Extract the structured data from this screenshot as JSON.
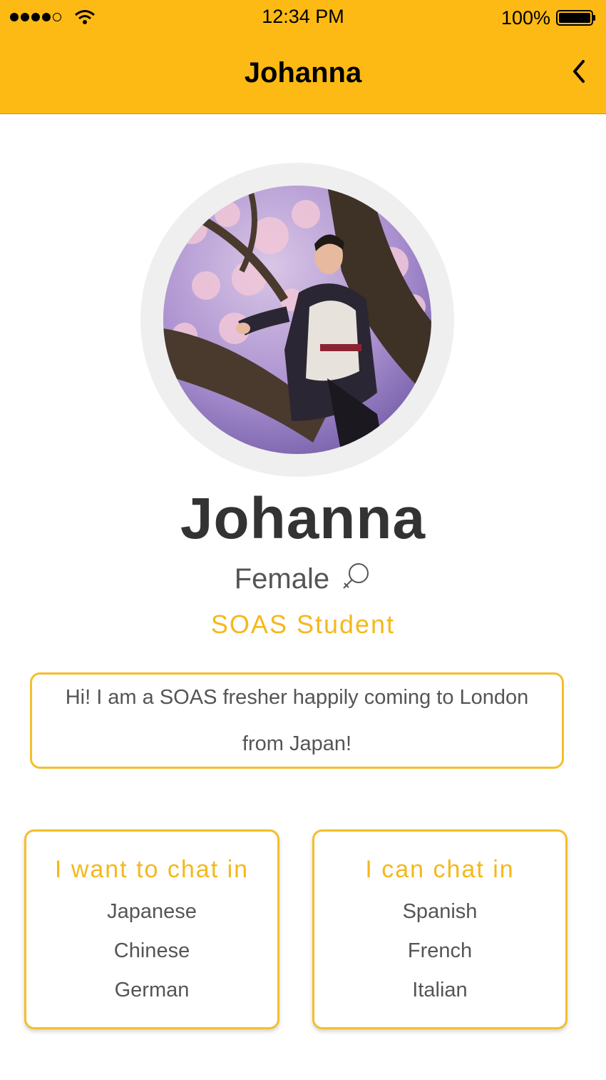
{
  "status_bar": {
    "time": "12:34 PM",
    "battery": "100%",
    "signal_icon": "signal-icon",
    "wifi_icon": "wifi-icon",
    "battery_icon": "battery-icon"
  },
  "nav": {
    "title": "Johanna",
    "back_icon": "chevron-left-icon",
    "background": "#FDBA14"
  },
  "profile": {
    "name": "Johanna",
    "gender": "Female",
    "gender_icon": "female-symbol-icon",
    "role": "SOAS Student",
    "bio": "Hi! I am a SOAS fresher happily coming to London from Japan!"
  },
  "want_to_chat": {
    "title": "I want to chat in",
    "languages": [
      "Japanese",
      "Chinese",
      "German"
    ]
  },
  "can_chat": {
    "title": "I can chat in",
    "languages": [
      "Spanish",
      "French",
      "Italian"
    ]
  },
  "colors": {
    "accent": "#F5B81C",
    "text_dark": "#333333",
    "text_muted": "#555555"
  }
}
